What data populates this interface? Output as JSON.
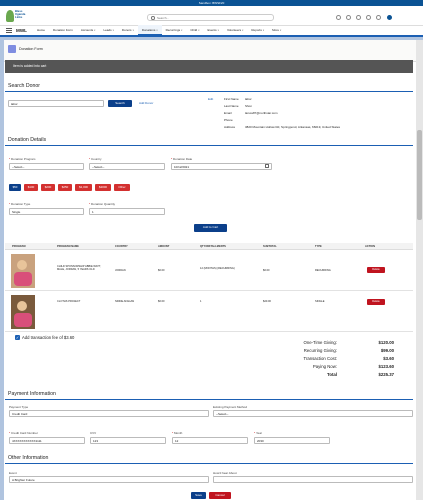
{
  "browser": {
    "title": "Sandbox: BWSF20"
  },
  "header": {
    "logo_text": "Bless\nUganda\nLinks",
    "search_placeholder": "Search..."
  },
  "nav": {
    "app_name": "MWL",
    "items": [
      {
        "label": "Home",
        "dropdown": false
      },
      {
        "label": "Donation Form",
        "dropdown": false
      },
      {
        "label": "Accounts",
        "dropdown": true
      },
      {
        "label": "Leads",
        "dropdown": true
      },
      {
        "label": "Donors",
        "dropdown": true
      },
      {
        "label": "Donations",
        "dropdown": true,
        "active": true
      },
      {
        "label": "Recurrings",
        "dropdown": true
      },
      {
        "label": "Child",
        "dropdown": true
      },
      {
        "label": "Events",
        "dropdown": true
      },
      {
        "label": "Volunteers",
        "dropdown": true
      },
      {
        "label": "Reports",
        "dropdown": true
      },
      {
        "label": "More",
        "dropdown": true
      }
    ]
  },
  "page": {
    "title": "Donation Form",
    "toast": "Item is added into cart",
    "search_donor": {
      "heading": "Search Donor",
      "input_value": "labor",
      "search_button": "Search",
      "add_donor_link": "Add Donor",
      "edit_link": "Edit",
      "details": [
        {
          "key": "First Name",
          "value": "labor"
        },
        {
          "key": "Last Name",
          "value": "Shon"
        },
        {
          "key": "Email",
          "value": "laruss87@northstar.com"
        },
        {
          "key": "Phone",
          "value": ""
        },
        {
          "key": "Address",
          "value": "3820 Mountain Hollow Rd, Springpond, Arkansas, 66019, United States"
        }
      ]
    },
    "donation_details": {
      "heading": "Donation Details",
      "program": {
        "label": "Donation Program",
        "value": "--Select--"
      },
      "country": {
        "label": "Country",
        "value": "--Select--"
      },
      "date": {
        "label": "Donation Date",
        "value": "10/12/2021"
      },
      "amounts": [
        "$50",
        "$100",
        "$200",
        "$250",
        "$1,000",
        "$2000",
        "Other"
      ],
      "selected_amount_index": 0,
      "type": {
        "label": "Donation Type",
        "value": "Single"
      },
      "quantity": {
        "label": "Donation Quantity",
        "value": "1"
      },
      "add_to_cart": "Add to Cart"
    },
    "cart": {
      "columns": [
        "PROGRAM",
        "PROGRAM NAME",
        "COUNTRY",
        "AMOUNT",
        "QTY/INSTALLMENTS",
        "SUBTOTAL",
        "TYPE",
        "ACTION"
      ],
      "rows": [
        {
          "program_name": "CHILD SPONSORSHIP ABBIE WATT, MALE, JORDAN, 5 YEARS OLD",
          "country": "JORDAN",
          "amount": "$0.00",
          "qty": "12 (MONTHS) (RECURRING)",
          "subtotal": "$0.00",
          "type": "RECURRING",
          "action": "Delete"
        },
        {
          "program_name": "CLOTHS PROJECT",
          "country": "NIDDE AFAGAN",
          "amount": "$0.00",
          "qty": "1",
          "subtotal": "$20.00",
          "type": "SINGLE",
          "action": "Delete"
        }
      ]
    },
    "fee": {
      "label": "Add transaction fee of $3.60",
      "checked": true
    },
    "summary": [
      {
        "key": "One-Time Giving:",
        "value": "$120.00"
      },
      {
        "key": "Recurring Giving:",
        "value": "$99.00"
      },
      {
        "key": "Transaction Cost:",
        "value": "$3.60"
      },
      {
        "key": "Paying Now:",
        "value": "$123.60"
      },
      {
        "key": "Total",
        "value": "$225.37",
        "bold": true
      }
    ],
    "payment": {
      "heading": "Payment Information",
      "payment_type": {
        "label": "Payment Type",
        "value": "Credit Card"
      },
      "existing_method": {
        "label": "Existing Payment Method",
        "value": "--Select--"
      },
      "card_number": {
        "label": "Credit Card Number",
        "value": "4XXXXXXXXXXX1111"
      },
      "cvv": {
        "label": "CVV",
        "value": "123"
      },
      "month": {
        "label": "Month",
        "value": "12"
      },
      "year": {
        "label": "Year",
        "value": "2030"
      }
    },
    "other": {
      "heading": "Other Information",
      "event": {
        "label": "Event",
        "value": "A Brighter Future"
      },
      "how_heard": {
        "label": "How'd hear About",
        "value": ""
      },
      "save": "Save",
      "cancel": "Cancel"
    }
  },
  "colors": {
    "brand": "#0b3f8a",
    "danger": "#d3302f",
    "nav_accent": "#1b5fb3"
  }
}
